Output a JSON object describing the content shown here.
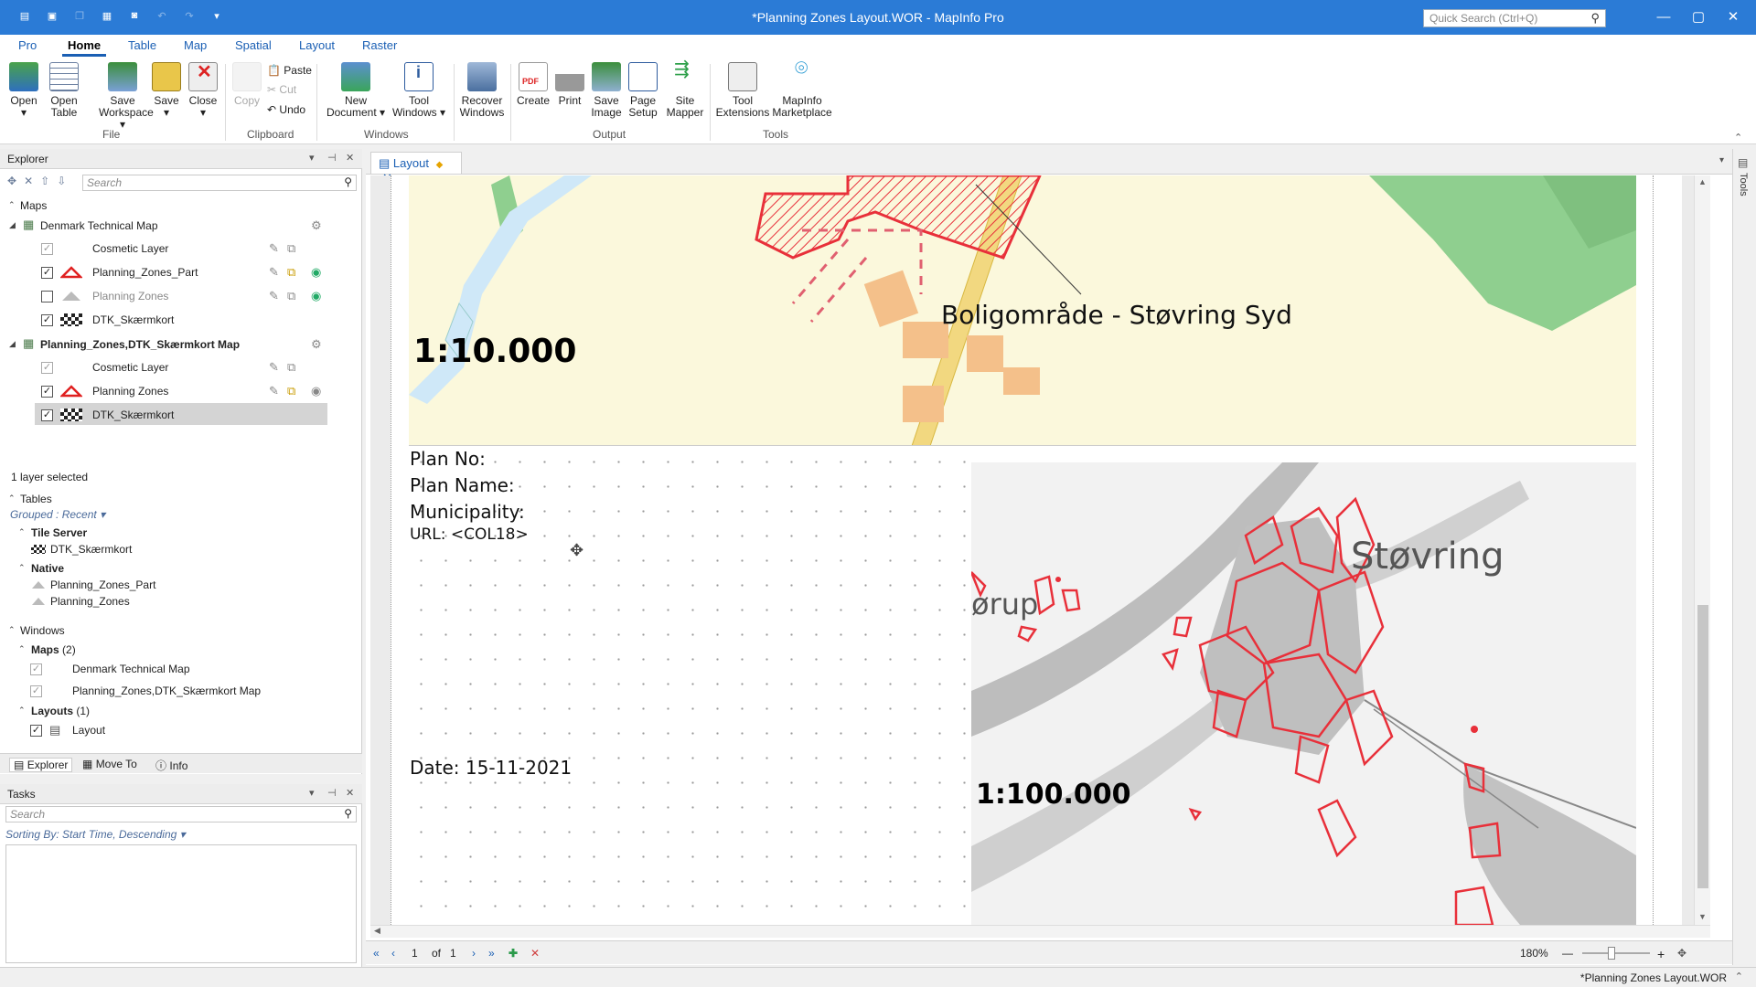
{
  "window": {
    "title": "*Planning Zones Layout.WOR - MapInfo Pro",
    "quick_search_placeholder": "Quick Search (Ctrl+Q)"
  },
  "ribbon_tabs": [
    "Pro",
    "Home",
    "Table",
    "Map",
    "Spatial",
    "Layout",
    "Raster"
  ],
  "active_tab": "Home",
  "ribbon": {
    "file": {
      "label": "File",
      "open": "Open",
      "open_table": "Open Table",
      "save_workspace": "Save Workspace",
      "save": "Save",
      "close": "Close"
    },
    "clipboard": {
      "label": "Clipboard",
      "copy": "Copy",
      "paste": "Paste",
      "cut": "Cut",
      "undo": "Undo"
    },
    "windows": {
      "label": "Windows",
      "new_document": "New Document",
      "tool_windows": "Tool Windows",
      "recover_windows": "Recover Windows"
    },
    "output": {
      "label": "Output",
      "create": "Create",
      "print": "Print",
      "save_image": "Save Image",
      "page_setup": "Page Setup",
      "site_mapper": "Site Mapper"
    },
    "tools": {
      "label": "Tools",
      "tool_extensions": "Tool Extensions",
      "marketplace": "MapInfo Marketplace"
    }
  },
  "explorer": {
    "title": "Explorer",
    "search_placeholder": "Search",
    "maps_header": "Maps",
    "map1": {
      "name": "Denmark Technical Map",
      "layers": [
        {
          "name": "Cosmetic Layer",
          "checked": "✓"
        },
        {
          "name": "Planning_Zones_Part",
          "checked": "✓"
        },
        {
          "name": "Planning Zones",
          "checked": ""
        },
        {
          "name": "DTK_Skærmkort",
          "checked": "✓"
        }
      ]
    },
    "map2": {
      "name": "Planning_Zones,DTK_Skærmkort Map",
      "layers": [
        {
          "name": "Cosmetic Layer",
          "checked": "✓"
        },
        {
          "name": "Planning Zones",
          "checked": "✓"
        },
        {
          "name": "DTK_Skærmkort",
          "checked": "✓"
        }
      ]
    },
    "layer_status": "1 layer selected",
    "tables_header": "Tables",
    "grouped": "Grouped : Recent",
    "tile_server": "Tile Server",
    "tile_items": [
      "DTK_Skærmkort"
    ],
    "native": "Native",
    "native_items": [
      "Planning_Zones_Part",
      "Planning_Zones"
    ],
    "windows_header": "Windows",
    "maps_group": "Maps",
    "maps_count": "(2)",
    "window_maps": [
      "Denmark Technical Map",
      "Planning_Zones,DTK_Skærmkort Map"
    ],
    "layouts_group": "Layouts",
    "layouts_count": "(1)",
    "window_layouts": [
      "Layout"
    ],
    "bottom_tabs": [
      "Explorer",
      "Move To",
      "Info"
    ]
  },
  "tasks": {
    "title": "Tasks",
    "search_placeholder": "Search",
    "sorting": "Sorting By: Start Time, Descending"
  },
  "document": {
    "tab_label": "Layout",
    "top_map": {
      "label": "Boligområde - Støvring Syd",
      "scale": "1:10.000"
    },
    "info": {
      "plan_no": "Plan No:",
      "plan_name": "Plan Name:",
      "municipality": "Municipality:",
      "url": "URL: <COL18>",
      "date": "Date: 15-11-2021"
    },
    "bottom_map": {
      "town_right": "Støvring",
      "town_left": "ørup",
      "scale": "1:100.000"
    }
  },
  "pager": {
    "page": "1",
    "of": "of",
    "total": "1",
    "zoom": "180%"
  },
  "statusbar": {
    "workspace": "*Planning Zones Layout.WOR"
  },
  "right_rail": {
    "tools": "Tools"
  },
  "colors": {
    "titlebar": "#2b7bd6",
    "accent": "#1a5fb4",
    "zone_red": "#e8303a",
    "map_yellow": "#fbf8dc",
    "map_green": "#8fcf8f"
  }
}
